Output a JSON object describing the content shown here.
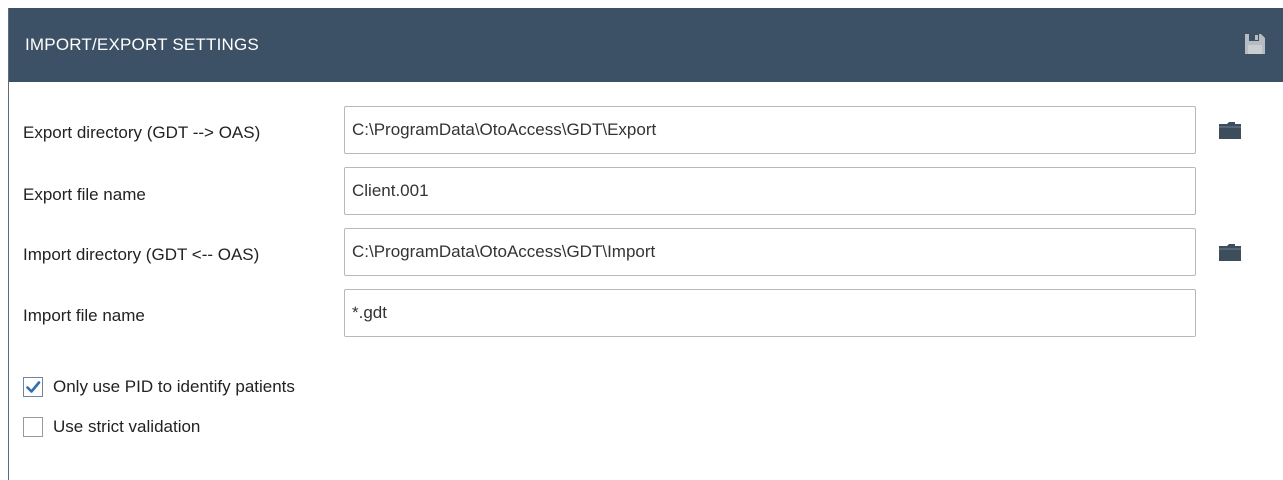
{
  "panel": {
    "title": "IMPORT/EXPORT SETTINGS",
    "save_icon": "save-disk-icon",
    "header_color": "#3d5166"
  },
  "fields": {
    "export_directory": {
      "label": "Export directory (GDT --> OAS)",
      "value": "C:\\ProgramData\\OtoAccess\\GDT\\Export",
      "browse_icon": "folder-icon"
    },
    "export_file_name": {
      "label": "Export file name",
      "value": "Client.001"
    },
    "import_directory": {
      "label": "Import directory (GDT <-- OAS)",
      "value": "C:\\ProgramData\\OtoAccess\\GDT\\Import",
      "browse_icon": "folder-icon"
    },
    "import_file_name": {
      "label": "Import file name",
      "value": "*.gdt"
    }
  },
  "options": {
    "only_pid": {
      "label": "Only use PID to identify patients",
      "checked": true
    },
    "strict_validation": {
      "label": "Use strict validation",
      "checked": false
    }
  }
}
